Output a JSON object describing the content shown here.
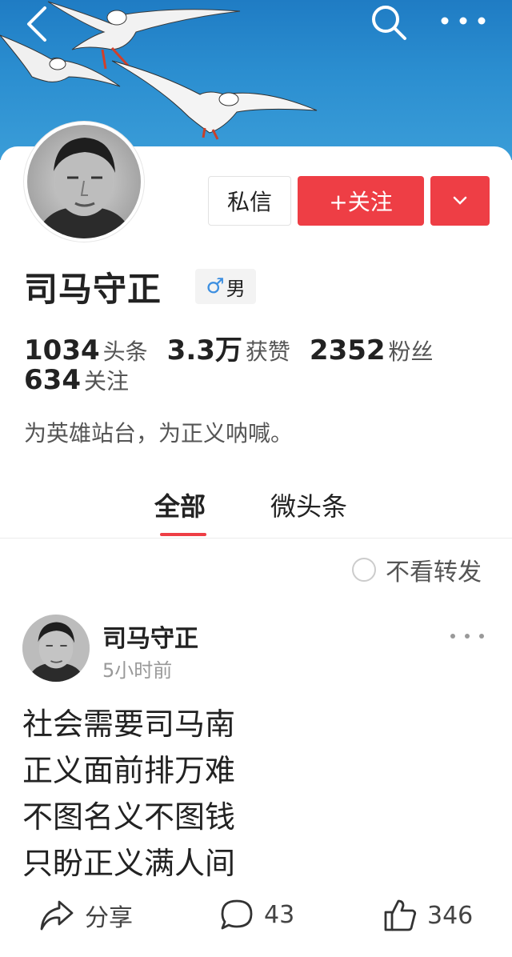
{
  "header": {
    "icons": [
      "back-icon",
      "search-icon",
      "more-icon"
    ]
  },
  "profile": {
    "name": "司马守正",
    "gender_symbol": "♂",
    "gender_label": "男",
    "message_button": "私信",
    "follow_button": "+关注",
    "stats": [
      {
        "value": "1034",
        "label": "头条"
      },
      {
        "value": "3.3万",
        "label": "获赞"
      },
      {
        "value": "2352",
        "label": "粉丝"
      },
      {
        "value": "634",
        "label": "关注"
      }
    ],
    "bio": "为英雄站台，为正义呐喊。"
  },
  "tabs": [
    {
      "label": "全部",
      "active": true
    },
    {
      "label": "微头条",
      "active": false
    }
  ],
  "filter": {
    "label": "不看转发"
  },
  "post": {
    "author": "司马守正",
    "time": "5小时前",
    "lines": [
      "社会需要司马南",
      "正义面前排万难",
      "不图名义不图钱",
      "只盼正义满人间"
    ],
    "share_label": "分享",
    "comment_count": "43",
    "like_count": "346"
  },
  "colors": {
    "accent": "#ee3e45",
    "banner_sky": "#2b8ed0",
    "gender_icon": "#3d8fe0"
  }
}
